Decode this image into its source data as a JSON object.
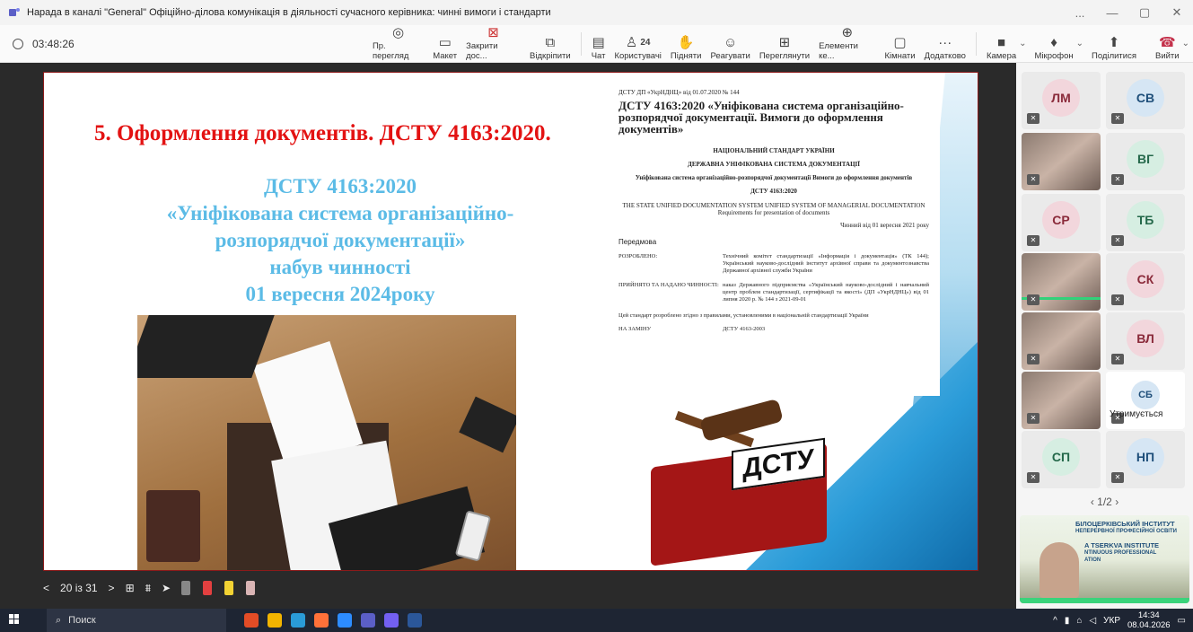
{
  "window": {
    "title": "Нарада в каналі \"General\" Офіційно-ділова комунікація в діяльності сучасного керівника: чинні вимоги і стандарти",
    "controls": [
      "...",
      "—",
      "▢",
      "✕"
    ]
  },
  "toolbar": {
    "timer": "03:48:26",
    "items": [
      {
        "label": "Пр. перегляд",
        "icon": "preview-icon"
      },
      {
        "label": "Макет",
        "icon": "layout-icon"
      },
      {
        "label": "Закрити дос...",
        "icon": "close-share-icon"
      },
      {
        "label": "Відкріпити",
        "icon": "unpin-icon"
      },
      {
        "label": "Чат",
        "icon": "chat-icon"
      },
      {
        "label": "Користувачі",
        "icon": "people-icon",
        "count": "24"
      },
      {
        "label": "Підняти",
        "icon": "raise-hand-icon"
      },
      {
        "label": "Реагувати",
        "icon": "react-icon"
      },
      {
        "label": "Переглянути",
        "icon": "view-icon"
      },
      {
        "label": "Елементи ке...",
        "icon": "apps-icon"
      },
      {
        "label": "Кімнати",
        "icon": "rooms-icon"
      },
      {
        "label": "Додатково",
        "icon": "more-icon"
      },
      {
        "label": "Камера",
        "icon": "camera-icon"
      },
      {
        "label": "Мікрофон",
        "icon": "mic-icon"
      },
      {
        "label": "Поділитися",
        "icon": "share-icon"
      },
      {
        "label": "Вийти",
        "icon": "leave-icon"
      }
    ]
  },
  "slide": {
    "heading": "5.  Оформлення документів. ДСТУ 4163:2020.",
    "subtitle_lines": [
      "ДСТУ 4163:2020",
      "«Уніфікована система організаційно-",
      "розпорядчої документації»",
      "набув чинності",
      "01 вересня 2024року"
    ],
    "doc": {
      "header": "ДСТУ ДП «УкрНДНЦ» від 01.07.2020 № 144",
      "title": "ДСТУ 4163:2020 «Уніфікована система організаційно-розпорядчої документації. Вимоги до оформлення документів»",
      "l1": "НАЦІОНАЛЬНИЙ СТАНДАРТ УКРАЇНИ",
      "l2": "ДЕРЖАВНА УНІФІКОВАНА СИСТЕМА ДОКУМЕНТАЦІЇ",
      "l3": "Уніфікована система організаційно-розпорядчої документації Вимоги до оформлення документів",
      "l4": "ДСТУ 4163:2020",
      "en": "THE STATE UNIFIED DOCUMENTATION SYSTEM UNIFIED SYSTEM OF MANAGERIAL DOCUMENTATION Requirements for presentation of documents",
      "valid": "Чинний від 01 вересня 2021 року",
      "preface": "Передмова",
      "r1k": "РОЗРОБЛЕНО:",
      "r1v": "Технічний комітет стандартизації «Інформація і документація» (ТК 144); Український науково-дослідний інститут архівної справи та документознавства Державної архівної служби України",
      "r2k": "ПРИЙНЯТО ТА НАДАНО ЧИННОСТІ:",
      "r2v": "наказ Державного підприємства «Український науково-дослідний і навчальний центр проблем стандартизації, сертифікації та якості» (ДП «УкрНДНЦ») від 01 липня 2020 р. № 144 з 2021-09-01",
      "p": "Цей стандарт розроблено згідно з правилами, установленими в національній стандартизації України",
      "r3k": "НА ЗАМІНУ",
      "r3v": "ДСТУ 4163-2003"
    },
    "book_label": "ДСТУ"
  },
  "slide_controls": {
    "prev": "<",
    "page": "20 із 31",
    "next": ">",
    "pens": [
      "#ffffff",
      "#888888",
      "#e34040",
      "#f2d233",
      "#d9b4b4"
    ]
  },
  "participants": [
    {
      "initials": "ЛМ",
      "style": "pink",
      "video": false
    },
    {
      "initials": "СВ",
      "style": "blue",
      "video": false
    },
    {
      "initials": "",
      "style": "",
      "video": true
    },
    {
      "initials": "ВГ",
      "style": "green",
      "video": false
    },
    {
      "initials": "СР",
      "style": "pink",
      "video": false
    },
    {
      "initials": "ТБ",
      "style": "green",
      "video": false
    },
    {
      "initials": "",
      "style": "",
      "video": true
    },
    {
      "initials": "СК",
      "style": "pink",
      "video": false
    },
    {
      "initials": "",
      "style": "",
      "video": true
    },
    {
      "initials": "ВЛ",
      "style": "pink",
      "video": false
    },
    {
      "initials": "",
      "style": "",
      "video": true
    },
    {
      "initials": "СБ",
      "style": "blue",
      "video": false
    },
    {
      "initials": "СП",
      "style": "green",
      "video": false
    },
    {
      "initials": "НП",
      "style": "blue",
      "video": false
    }
  ],
  "hand_status": "Утримується",
  "pager": "1/2",
  "institute": {
    "line1": "БІЛОЦЕРКІВСЬКИЙ ІНСТИТУТ",
    "line1b": "НЕПЕРЕРВНОЇ ПРОФЕСІЙНОЇ ОСВІТИ",
    "line2": "A TSERKVA INSTITUTE",
    "line2b": "NTINUOUS PROFESSIONAL",
    "line2c": "ATION"
  },
  "taskbar": {
    "search": "Поиск",
    "lang": "УКР",
    "time": "14:34",
    "date": "08.04.2026"
  }
}
